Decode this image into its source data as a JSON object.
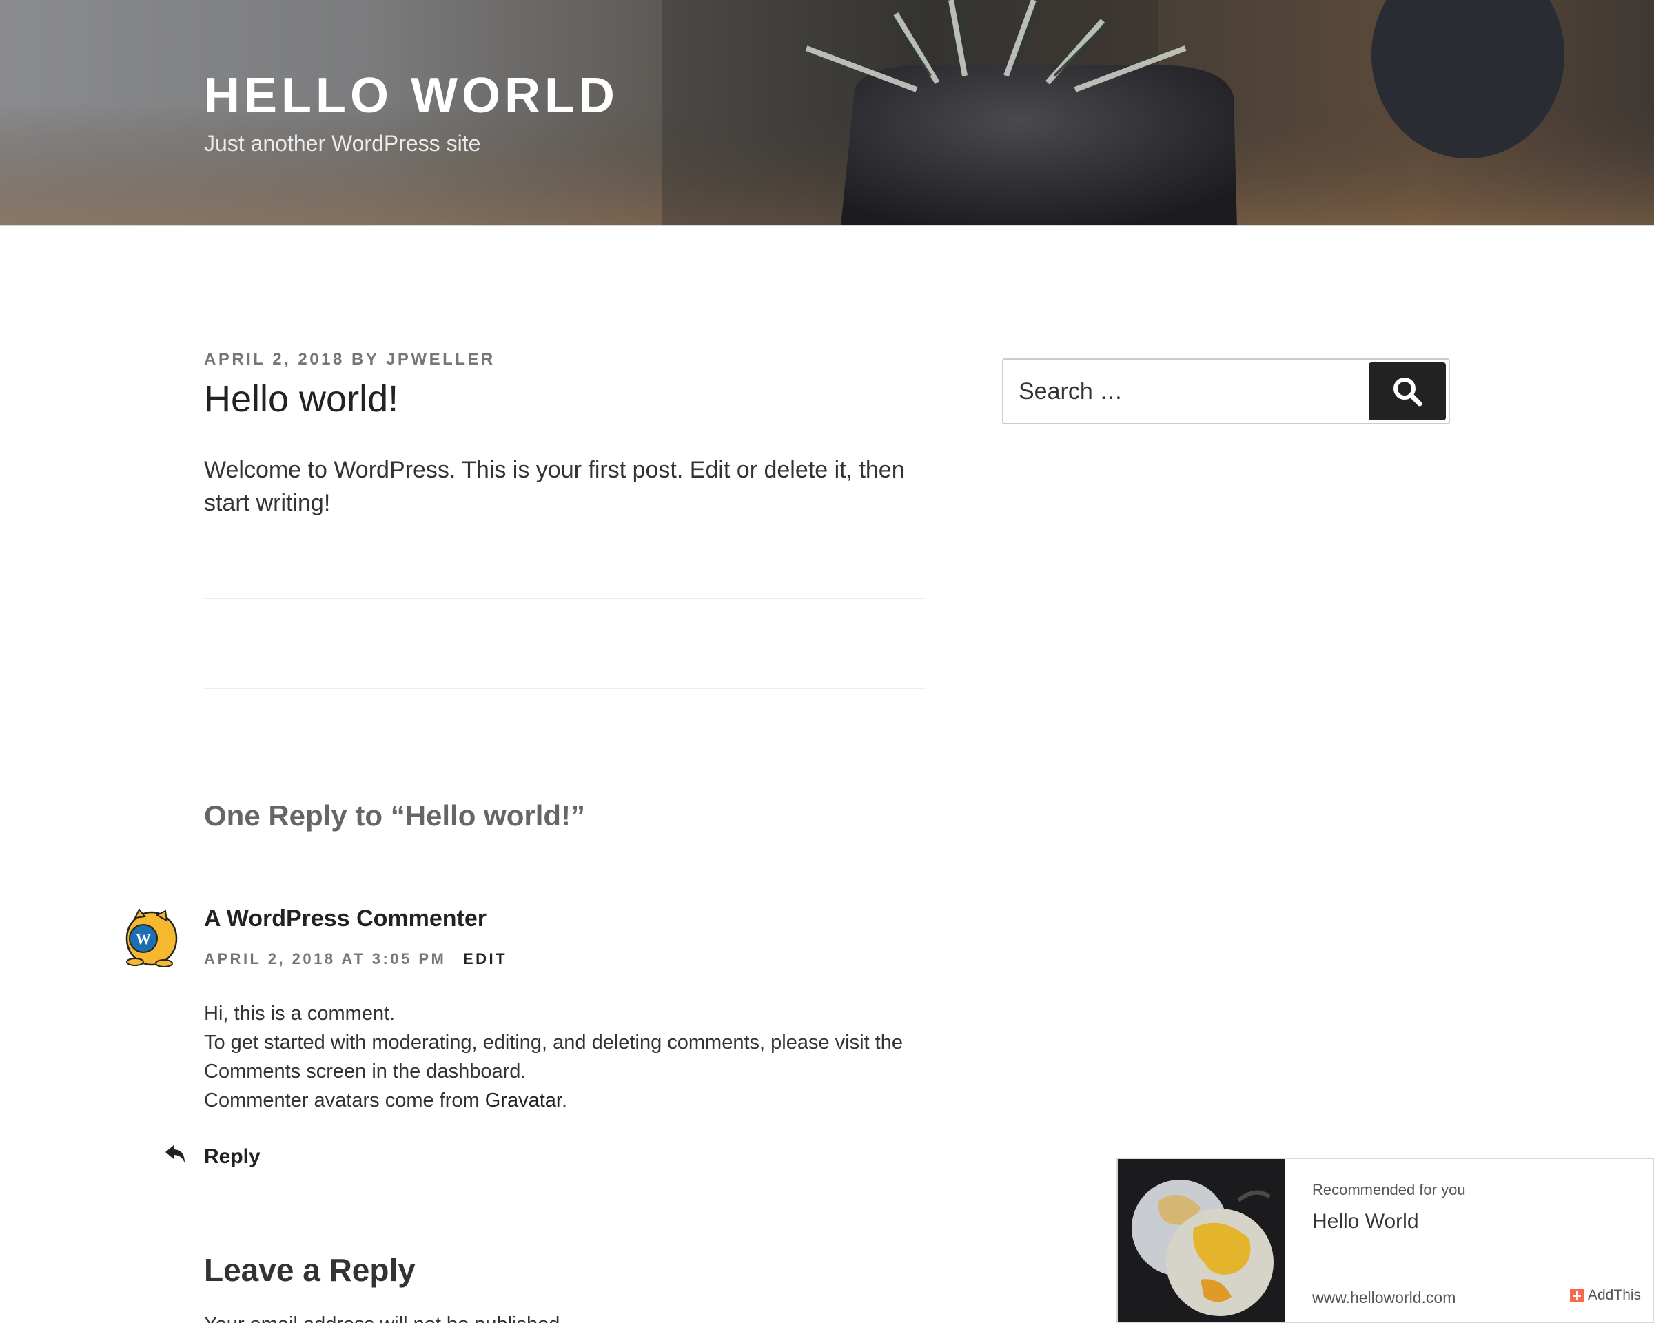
{
  "header": {
    "site_title": "HELLO WORLD",
    "site_description": "Just another WordPress site"
  },
  "post": {
    "date": "APRIL 2, 2018",
    "by": "BY",
    "author": "JPWELLER",
    "title": "Hello world!",
    "content": "Welcome to WordPress. This is your first post. Edit or delete it, then start writing!"
  },
  "sidebar": {
    "search": {
      "placeholder": "Search …"
    }
  },
  "comments": {
    "heading": "One Reply to “Hello world!”",
    "items": [
      {
        "author": "A WordPress Commenter",
        "date": "APRIL 2, 2018 AT 3:05 PM",
        "edit_label": "EDIT",
        "lines": [
          "Hi, this is a comment.",
          "To get started with moderating, editing, and deleting comments, please visit the Comments screen in the dashboard.",
          "Commenter avatars come from"
        ],
        "gravatar_link": "Gravatar",
        "after_link": ".",
        "reply_label": "Reply"
      }
    ]
  },
  "respond": {
    "title": "Leave a Reply",
    "notes": "Your email address will not be published."
  },
  "recommendation": {
    "label": "Recommended for you",
    "title": "Hello World",
    "url": "www.helloworld.com",
    "brand": "AddThis"
  },
  "colors": {
    "accent": "#222222",
    "meta_gray": "#767676",
    "addthis_orange": "#f8694d"
  }
}
